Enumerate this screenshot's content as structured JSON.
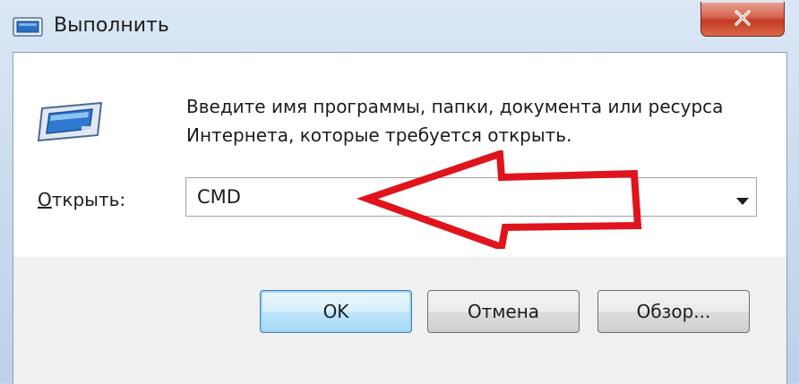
{
  "window": {
    "title": "Выполнить",
    "title_icon": "run-icon",
    "close_icon": "close-icon"
  },
  "dialog": {
    "icon": "run-program-icon",
    "description_line1": "Введите имя программы, папки, документа или ресурса",
    "description_line2": "Интернета, которые требуется открыть.",
    "open_label_accel": "О",
    "open_label_rest": "ткрыть:",
    "input_value": "CMD",
    "dropdown_icon": "chevron-down-icon"
  },
  "buttons": {
    "ok": "OK",
    "cancel": "Отмена",
    "browse": "Обзор..."
  },
  "annotation": {
    "arrow_color": "#e0141c",
    "arrow_icon": "red-arrow-left-icon"
  },
  "colors": {
    "title_bar": "#c9dcef",
    "close_button": "#c33a22",
    "default_button_border": "#3c7fb1"
  }
}
